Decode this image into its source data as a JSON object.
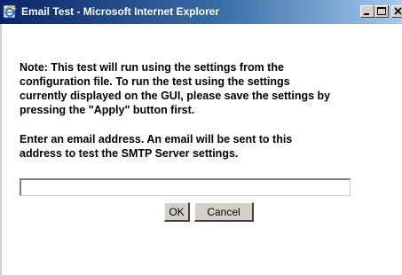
{
  "window": {
    "title": "Email Test - Microsoft Internet Explorer",
    "icon": "internet-explorer-icon",
    "controls": [
      "minimize-icon",
      "maximize-icon",
      "close-icon"
    ]
  },
  "note": {
    "lines": [
      "Note: This test will run using the settings from the",
      "configuration file. To run the test using the settings",
      "currently displayed on the GUI, please save the settings by",
      "pressing the \"Apply\" button first."
    ]
  },
  "prompt": {
    "lines": [
      "Enter an email address. An email will be sent to this",
      "address to test the SMTP Server settings."
    ]
  },
  "email_input": {
    "value": "",
    "placeholder": ""
  },
  "buttons": {
    "ok_label": "OK",
    "cancel_label": "Cancel"
  },
  "colors": {
    "titlebar_start": "#0a246a",
    "titlebar_end": "#a6caf0",
    "button_face": "#d4d0c8"
  }
}
